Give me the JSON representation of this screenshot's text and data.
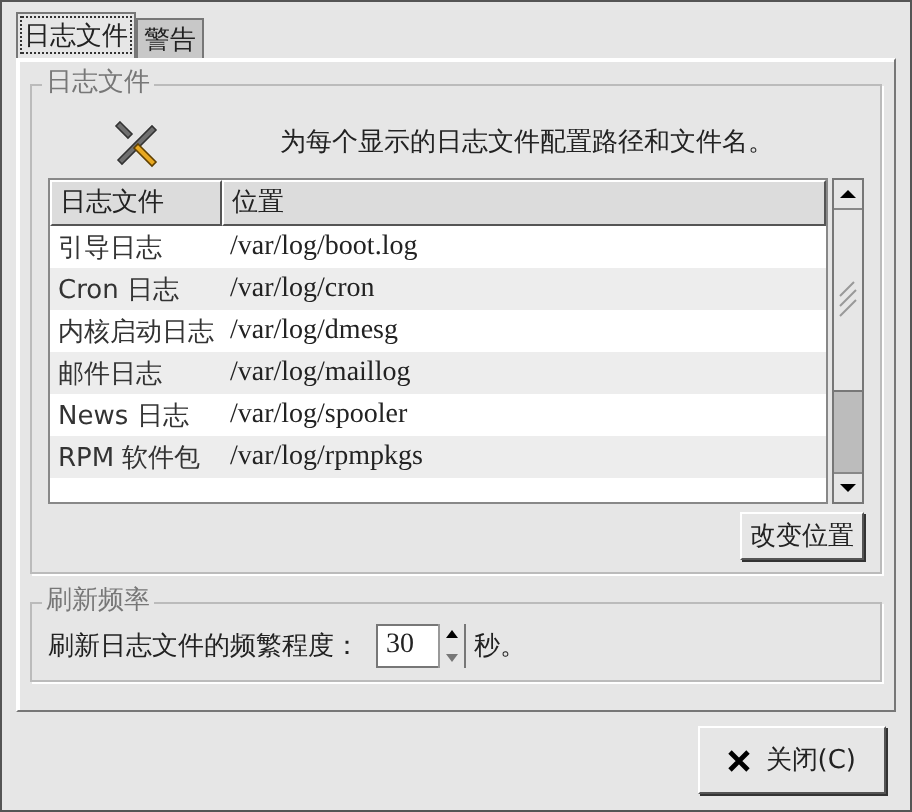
{
  "tabs": [
    {
      "label": "日志文件",
      "selected": true
    },
    {
      "label": "警告",
      "selected": false
    }
  ],
  "log_files": {
    "title": "日志文件",
    "description": "为每个显示的日志文件配置路径和文件名。",
    "table": {
      "columns": [
        "日志文件",
        "位置"
      ],
      "rows": [
        {
          "name": "引导日志",
          "location": "/var/log/boot.log"
        },
        {
          "name": "Cron 日志",
          "location": "/var/log/cron"
        },
        {
          "name": "内核启动日志",
          "location": "/var/log/dmesg"
        },
        {
          "name": "邮件日志",
          "location": "/var/log/maillog"
        },
        {
          "name": "News 日志",
          "location": "/var/log/spooler"
        },
        {
          "name": "RPM 软件包",
          "location": "/var/log/rpmpkgs"
        }
      ]
    },
    "change_button": "改变位置"
  },
  "refresh": {
    "title": "刷新频率",
    "label": "刷新日志文件的频繁程度：",
    "value": "30",
    "unit": "秒。"
  },
  "close_button": "关闭(C)"
}
